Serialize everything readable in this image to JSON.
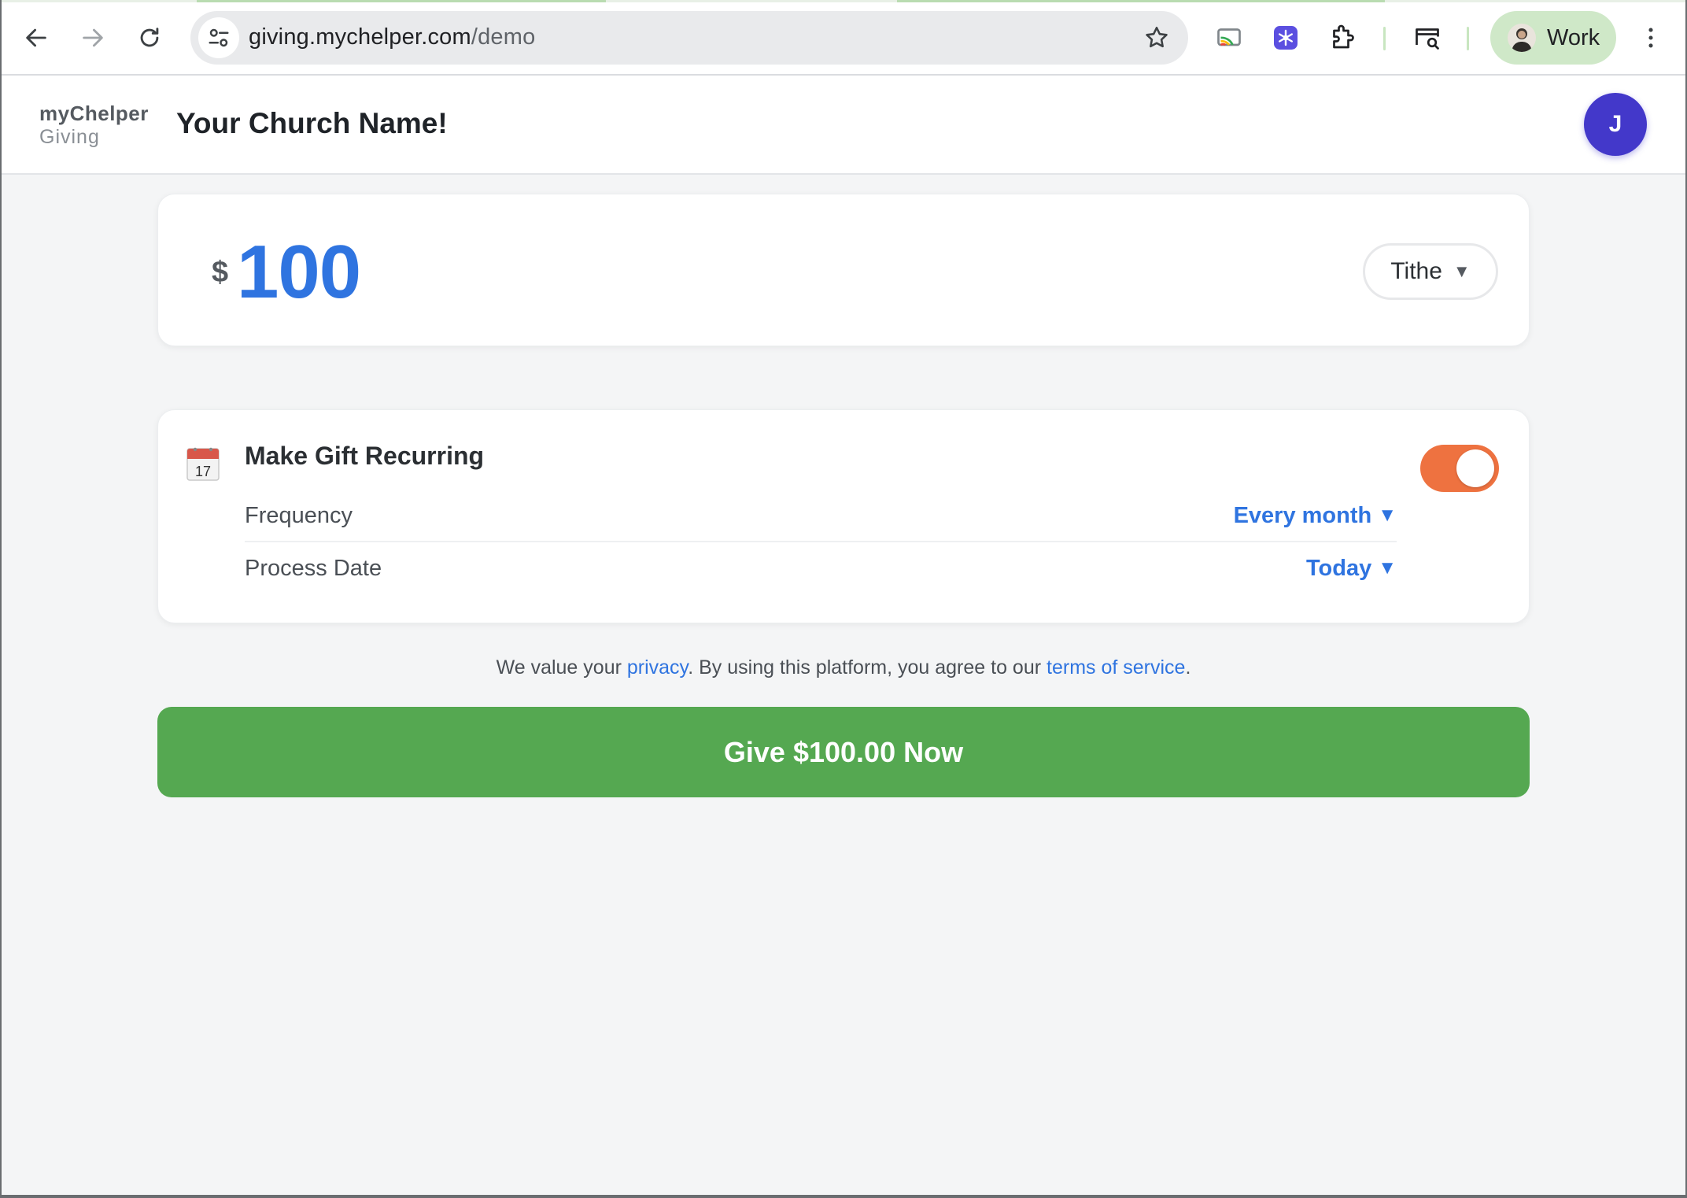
{
  "browser": {
    "url_host": "giving.mychelper.com",
    "url_path": "/demo",
    "profile_name": "Work",
    "icons": {
      "back": "arrow-left-icon",
      "forward": "arrow-right-icon",
      "reload": "reload-icon",
      "site_info": "tune-icon",
      "bookmark": "star-icon",
      "cast": "cast-icon",
      "extension_snowflake": "snowflake-icon",
      "extensions": "puzzle-icon",
      "side_panel": "search-tab-icon",
      "menu": "kebab-menu-icon"
    },
    "accent_color": "#cfe8c8"
  },
  "header": {
    "brand_top": "myChelper",
    "brand_bottom": "Giving",
    "church_name": "Your Church Name!",
    "user_initial": "J",
    "avatar_color": "#4338ca"
  },
  "amount": {
    "currency_symbol": "$",
    "value": "100",
    "fund": "Tithe",
    "value_color": "#2f74e0"
  },
  "recurring": {
    "icon": "calendar-icon",
    "calendar_day": "17",
    "title": "Make Gift Recurring",
    "enabled": true,
    "toggle_color": "#ee7240",
    "frequency_label": "Frequency",
    "frequency_value": "Every month",
    "process_date_label": "Process Date",
    "process_date_value": "Today"
  },
  "legal": {
    "prefix": "We value your ",
    "privacy_link": "privacy",
    "middle": ". By using this platform, you agree to our ",
    "terms_link": "terms of service",
    "suffix": "."
  },
  "cta": {
    "label": "Give $100.00 Now",
    "color": "#55a851"
  }
}
